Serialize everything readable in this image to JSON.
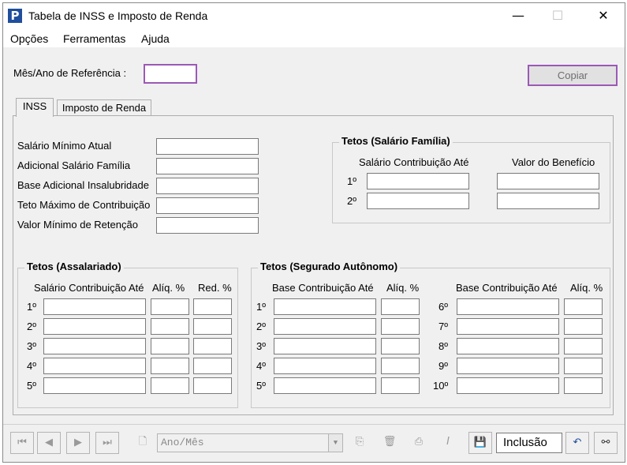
{
  "window": {
    "title": "Tabela de INSS e Imposto de Renda",
    "icon_letter": "P",
    "minimize": "—",
    "maximize": "☐",
    "close": "✕"
  },
  "menu": [
    {
      "label": "Opções"
    },
    {
      "label": "Ferramentas"
    },
    {
      "label": "Ajuda"
    }
  ],
  "reference": {
    "label": "Mês/Ano de Referência :",
    "value": ""
  },
  "copy_button": "Copiar",
  "tabs": [
    {
      "label": "INSS",
      "active": true
    },
    {
      "label": "Imposto de Renda",
      "active": false
    }
  ],
  "inss_fields": [
    {
      "label": "Salário Mínimo Atual",
      "value": ""
    },
    {
      "label": "Adicional Salário Família",
      "value": ""
    },
    {
      "label": "Base Adicional Insalubridade",
      "value": ""
    },
    {
      "label": "Teto Máximo de Contribuição",
      "value": ""
    },
    {
      "label": "Valor Mínimo de Retenção",
      "value": ""
    }
  ],
  "salario_familia": {
    "title": "Tetos (Salário Família)",
    "col1": "Salário Contribuição Até",
    "col2": "Valor do Benefício",
    "rows": [
      "1º",
      "2º"
    ]
  },
  "assalariado": {
    "title": "Tetos (Assalariado)",
    "col1": "Salário Contribuição Até",
    "col2": "Alíq. %",
    "col3": "Red. %",
    "rows": [
      "1º",
      "2º",
      "3º",
      "4º",
      "5º"
    ]
  },
  "autonomo": {
    "title": "Tetos (Segurado Autônomo)",
    "col1": "Base Contribuição Até",
    "col2": "Alíq. %",
    "rows_left": [
      "1º",
      "2º",
      "3º",
      "4º",
      "5º"
    ],
    "rows_right": [
      "6º",
      "7º",
      "8º",
      "9º",
      "10º"
    ]
  },
  "statusbar": {
    "combo_text": "Ano/Mês",
    "mode": "Inclusão",
    "icons": [
      "first-icon",
      "prev-icon",
      "next-icon",
      "last-icon",
      "new-document-icon",
      "copy-icon",
      "delete-icon",
      "print-icon",
      "edit-icon",
      "save-icon",
      "undo-icon",
      "binoculars-icon"
    ]
  }
}
